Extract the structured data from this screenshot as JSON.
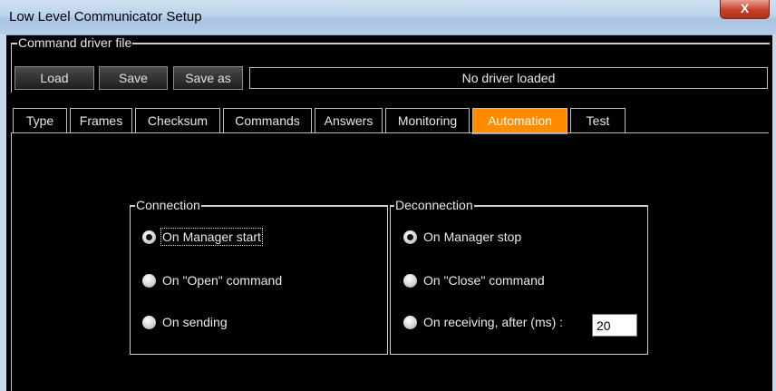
{
  "window": {
    "title": "Low Level Communicator Setup",
    "close_glyph": "X"
  },
  "command_driver": {
    "group_title": "Command driver file",
    "load_label": "Load",
    "save_label": "Save",
    "save_as_label": "Save as",
    "status": "No driver loaded"
  },
  "tabs": [
    {
      "label": "Type"
    },
    {
      "label": "Frames"
    },
    {
      "label": "Checksum"
    },
    {
      "label": "Commands"
    },
    {
      "label": "Answers"
    },
    {
      "label": "Monitoring"
    },
    {
      "label": "Automation",
      "active": true
    },
    {
      "label": "Test"
    }
  ],
  "connection": {
    "title": "Connection",
    "options": [
      {
        "label": "On Manager start",
        "checked": true
      },
      {
        "label": "On \"Open\" command",
        "checked": false
      },
      {
        "label": "On sending",
        "checked": false
      }
    ]
  },
  "deconnection": {
    "title": "Deconnection",
    "options": [
      {
        "label": "On Manager stop",
        "checked": true
      },
      {
        "label": "On \"Close\" command",
        "checked": false
      },
      {
        "label": "On receiving, after (ms) :",
        "checked": false
      }
    ],
    "delay_ms": "20"
  },
  "colors": {
    "active_tab": "#ff8c00",
    "background": "#000000"
  }
}
